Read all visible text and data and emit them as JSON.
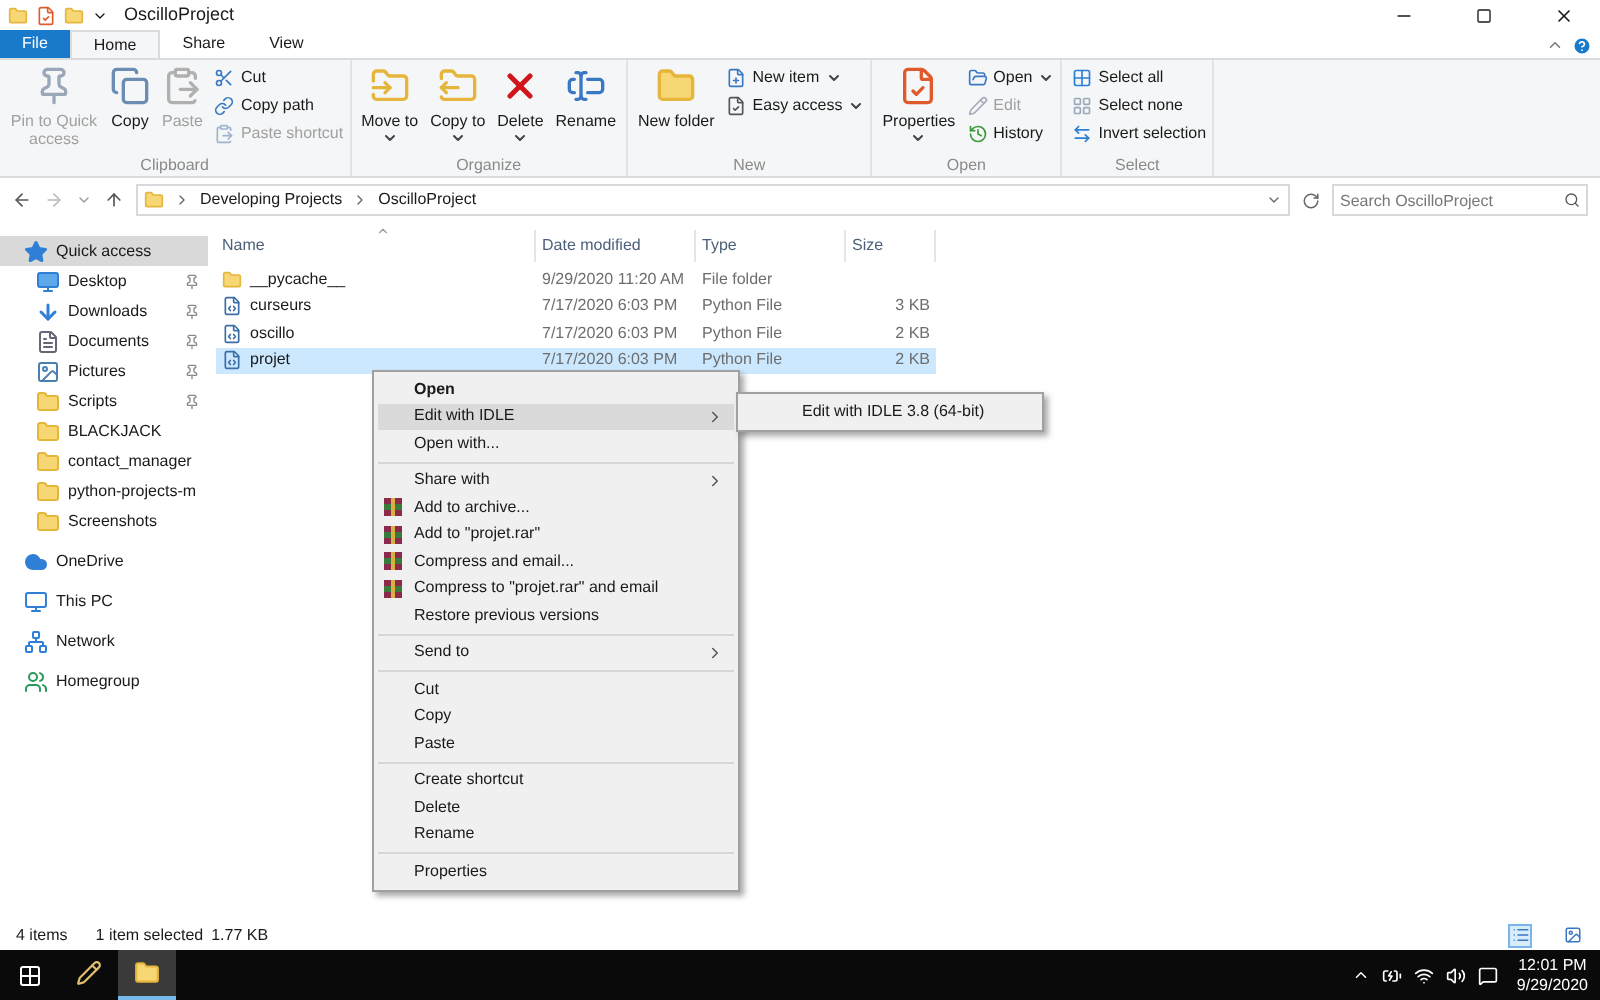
{
  "title_bar": {
    "title": "OscilloProject"
  },
  "ribbon_tabs": [
    {
      "label": "File",
      "kind": "file",
      "selected": false
    },
    {
      "label": "Home",
      "kind": "tab",
      "selected": true
    },
    {
      "label": "Share",
      "kind": "tab",
      "selected": false
    },
    {
      "label": "View",
      "kind": "tab",
      "selected": false
    }
  ],
  "ribbon_groups": [
    {
      "label": "Clipboard",
      "items": [
        {
          "label": "Pin to Quick access",
          "kind": "large",
          "disabled": true,
          "dropdown": false
        },
        {
          "label": "Copy",
          "kind": "large",
          "disabled": false,
          "dropdown": false
        },
        {
          "label": "Paste",
          "kind": "large",
          "disabled": true,
          "dropdown": false
        },
        {
          "label": "Cut",
          "kind": "small",
          "disabled": false,
          "dropdown": false
        },
        {
          "label": "Copy path",
          "kind": "small",
          "disabled": false,
          "dropdown": false
        },
        {
          "label": "Paste shortcut",
          "kind": "small",
          "disabled": true,
          "dropdown": false
        }
      ]
    },
    {
      "label": "Organize",
      "items": [
        {
          "label": "Move to",
          "kind": "large",
          "disabled": false,
          "dropdown": true
        },
        {
          "label": "Copy to",
          "kind": "large",
          "disabled": false,
          "dropdown": true
        },
        {
          "label": "Delete",
          "kind": "large",
          "disabled": false,
          "dropdown": true
        },
        {
          "label": "Rename",
          "kind": "large",
          "disabled": false,
          "dropdown": false
        }
      ]
    },
    {
      "label": "New",
      "items": [
        {
          "label": "New folder",
          "kind": "large",
          "disabled": false,
          "dropdown": false
        },
        {
          "label": "New item",
          "kind": "small",
          "disabled": false,
          "dropdown": true
        },
        {
          "label": "Easy access",
          "kind": "small",
          "disabled": false,
          "dropdown": true
        }
      ]
    },
    {
      "label": "Open",
      "items": [
        {
          "label": "Properties",
          "kind": "large",
          "disabled": false,
          "dropdown": true
        },
        {
          "label": "Open",
          "kind": "small",
          "disabled": false,
          "dropdown": true
        },
        {
          "label": "Edit",
          "kind": "small",
          "disabled": true,
          "dropdown": false
        },
        {
          "label": "History",
          "kind": "small",
          "disabled": false,
          "dropdown": false
        }
      ]
    },
    {
      "label": "Select",
      "items": [
        {
          "label": "Select all",
          "kind": "small",
          "disabled": false,
          "dropdown": false
        },
        {
          "label": "Select none",
          "kind": "small",
          "disabled": false,
          "dropdown": false
        },
        {
          "label": "Invert selection",
          "kind": "small",
          "disabled": false,
          "dropdown": false
        }
      ]
    }
  ],
  "address_bar": {
    "path": [
      "Developing Projects",
      "OscilloProject"
    ],
    "search_placeholder": "Search OscilloProject"
  },
  "navigation": [
    {
      "label": "Quick access",
      "kind": "star",
      "selected": true,
      "children": [
        {
          "label": "Desktop",
          "kind": "desktop",
          "pinned": true,
          "selected": false
        },
        {
          "label": "Downloads",
          "kind": "download",
          "pinned": true,
          "selected": false
        },
        {
          "label": "Documents",
          "kind": "document",
          "pinned": true,
          "selected": false
        },
        {
          "label": "Pictures",
          "kind": "pictures",
          "pinned": true,
          "selected": false
        },
        {
          "label": "Scripts",
          "kind": "folder",
          "pinned": true,
          "selected": false
        },
        {
          "label": "BLACKJACK",
          "kind": "folder",
          "pinned": false,
          "selected": false
        },
        {
          "label": "contact_manager",
          "kind": "folder",
          "pinned": false,
          "selected": false
        },
        {
          "label": "python-projects-m",
          "kind": "folder",
          "pinned": false,
          "selected": false
        },
        {
          "label": "Screenshots",
          "kind": "folder",
          "pinned": false,
          "selected": false
        }
      ]
    },
    {
      "label": "OneDrive",
      "kind": "cloud",
      "selected": false
    },
    {
      "label": "This PC",
      "kind": "pc",
      "selected": false
    },
    {
      "label": "Network",
      "kind": "network",
      "selected": false
    },
    {
      "label": "Homegroup",
      "kind": "homegroup",
      "selected": false
    }
  ],
  "columns": [
    {
      "label": "Name",
      "sorted": true
    },
    {
      "label": "Date modified",
      "sorted": false
    },
    {
      "label": "Type",
      "sorted": false
    },
    {
      "label": "Size",
      "sorted": false
    }
  ],
  "files": [
    {
      "name": "__pycache__",
      "date": "9/29/2020 11:20 AM",
      "type": "File folder",
      "kind": "folder",
      "selected": false
    },
    {
      "name": "curseurs",
      "date": "7/17/2020 6:03 PM",
      "type": "Python File",
      "size": "3 KB",
      "kind": "python",
      "selected": false
    },
    {
      "name": "oscillo",
      "date": "7/17/2020 6:03 PM",
      "type": "Python File",
      "size": "2 KB",
      "kind": "python",
      "selected": false
    },
    {
      "name": "projet",
      "date": "7/17/2020 6:03 PM",
      "type": "Python File",
      "size": "2 KB",
      "kind": "python",
      "selected": true
    }
  ],
  "context_menu": {
    "sections": [
      [
        {
          "label": "Open",
          "bold": true,
          "submenu": false,
          "kind": "plain",
          "selected": false
        },
        {
          "label": "Edit with IDLE",
          "bold": false,
          "submenu": true,
          "kind": "plain",
          "selected": true
        },
        {
          "label": "Open with...",
          "bold": false,
          "submenu": false,
          "kind": "plain",
          "selected": false
        }
      ],
      [
        {
          "label": "Share with",
          "bold": false,
          "submenu": true,
          "kind": "plain",
          "selected": false
        },
        {
          "label": "Add to archive...",
          "bold": false,
          "submenu": false,
          "kind": "archive",
          "selected": false
        },
        {
          "label": "Add to \"projet.rar\"",
          "bold": false,
          "submenu": false,
          "kind": "archive",
          "selected": false
        },
        {
          "label": "Compress and email...",
          "bold": false,
          "submenu": false,
          "kind": "archive",
          "selected": false
        },
        {
          "label": "Compress to \"projet.rar\" and email",
          "bold": false,
          "submenu": false,
          "kind": "archive",
          "selected": false
        },
        {
          "label": "Restore previous versions",
          "bold": false,
          "submenu": false,
          "kind": "plain",
          "selected": false
        }
      ],
      [
        {
          "label": "Send to",
          "bold": false,
          "submenu": true,
          "kind": "plain",
          "selected": false
        }
      ],
      [
        {
          "label": "Cut",
          "bold": false,
          "submenu": false,
          "kind": "plain",
          "selected": false
        },
        {
          "label": "Copy",
          "bold": false,
          "submenu": false,
          "kind": "plain",
          "selected": false
        },
        {
          "label": "Paste",
          "bold": false,
          "submenu": false,
          "kind": "plain",
          "selected": false
        }
      ],
      [
        {
          "label": "Create shortcut",
          "bold": false,
          "submenu": false,
          "kind": "plain",
          "selected": false
        },
        {
          "label": "Delete",
          "bold": false,
          "submenu": false,
          "kind": "plain",
          "selected": false
        },
        {
          "label": "Rename",
          "bold": false,
          "submenu": false,
          "kind": "plain",
          "selected": false
        }
      ],
      [
        {
          "label": "Properties",
          "bold": false,
          "submenu": false,
          "kind": "plain",
          "selected": false
        }
      ]
    ],
    "submenu": [
      "Edit with IDLE 3.8 (64-bit)"
    ]
  },
  "status_bar": {
    "item_count": "4 items",
    "selection": "1 item selected",
    "selection_size": "1.77 KB",
    "views": [
      {
        "kind": "details",
        "selected": true
      },
      {
        "kind": "tiles",
        "selected": false
      }
    ]
  },
  "taskbar": {
    "apps": [
      {
        "kind": "paint",
        "active": false
      },
      {
        "kind": "explorer",
        "active": true
      }
    ],
    "time": "12:01 PM",
    "date": "9/29/2020"
  }
}
